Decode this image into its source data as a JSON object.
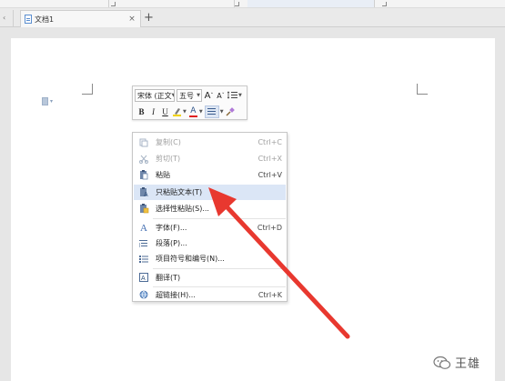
{
  "tabbar": {
    "active_tab_title": "文档1",
    "close_glyph": "×",
    "add_glyph": "+",
    "left_glyph": "‹"
  },
  "mini_toolbar": {
    "font_name": "宋体 (正文",
    "font_size": "五号",
    "grow_font": "A",
    "shrink_font": "A",
    "bold": "B",
    "italic": "I",
    "underline": "U",
    "font_color_letter": "A",
    "font_color": "#e02020",
    "highlight_color": "#f2d200"
  },
  "context_menu": {
    "items": [
      {
        "label": "复制(C)",
        "shortcut": "Ctrl+C",
        "icon": "copy-icon",
        "disabled": true
      },
      {
        "label": "剪切(T)",
        "shortcut": "Ctrl+X",
        "icon": "cut-icon",
        "disabled": true
      },
      {
        "label": "粘贴",
        "shortcut": "Ctrl+V",
        "icon": "paste-icon",
        "disabled": false
      },
      {
        "label": "只粘贴文本(T)",
        "shortcut": "",
        "icon": "paste-text-icon",
        "disabled": false,
        "highlighted": true
      },
      {
        "label": "选择性粘贴(S)...",
        "shortcut": "",
        "icon": "paste-special-icon",
        "disabled": false
      },
      {
        "label": "字体(F)...",
        "shortcut": "Ctrl+D",
        "icon": "font-icon",
        "disabled": false
      },
      {
        "label": "段落(P)...",
        "shortcut": "",
        "icon": "paragraph-icon",
        "disabled": false
      },
      {
        "label": "项目符号和编号(N)...",
        "shortcut": "",
        "icon": "bullets-icon",
        "disabled": false
      },
      {
        "label": "翻译(T)",
        "shortcut": "",
        "icon": "translate-icon",
        "disabled": false
      },
      {
        "label": "超链接(H)...",
        "shortcut": "Ctrl+K",
        "icon": "hyperlink-icon",
        "disabled": false
      }
    ]
  },
  "annotation": {
    "arrow_color": "#e8382f"
  },
  "watermark": {
    "text": "王雄"
  }
}
